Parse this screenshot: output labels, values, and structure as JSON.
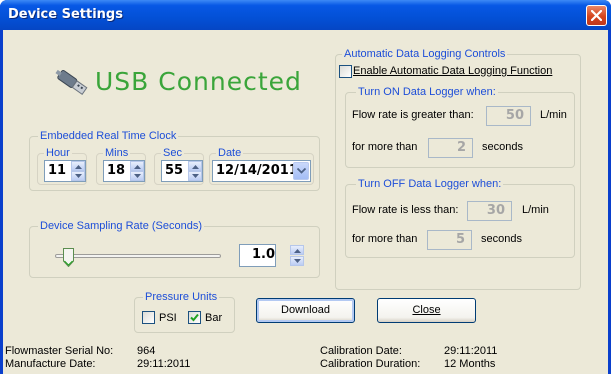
{
  "window": {
    "title": "Device Settings"
  },
  "usb": {
    "status_text": "USB Connected",
    "icon": "usb-plug-icon"
  },
  "rtc": {
    "group_label": "Embedded Real Time Clock",
    "hour_label": "Hour",
    "mins_label": "Mins",
    "sec_label": "Sec",
    "date_label": "Date",
    "hour_value": "11",
    "mins_value": "18",
    "sec_value": "55",
    "date_value": "12/14/2011"
  },
  "sampling": {
    "group_label": "Device Sampling Rate (Seconds)",
    "value": "1.0",
    "slider_level": 0.05
  },
  "logging": {
    "group_label": "Automatic Data Logging Controls",
    "enable_label": "Enable Automatic Data Logging Function",
    "enable_checked": false,
    "on_group_label": "Turn ON Data Logger when:",
    "on_flow_label": "Flow rate is greater than:",
    "on_flow_value": "50",
    "on_flow_unit": "L/min",
    "on_time_label": "for more than",
    "on_time_value": "2",
    "on_time_unit": "seconds",
    "off_group_label": "Turn OFF Data Logger when:",
    "off_flow_label": "Flow rate is less than:",
    "off_flow_value": "30",
    "off_flow_unit": "L/min",
    "off_time_label": "for more than",
    "off_time_value": "5",
    "off_time_unit": "seconds"
  },
  "pressure": {
    "group_label": "Pressure Units",
    "psi_label": "PSI",
    "psi_checked": false,
    "bar_label": "Bar",
    "bar_checked": true
  },
  "buttons": {
    "download_label": "Download",
    "close_label": "Close"
  },
  "info": {
    "serial_label": "Flowmaster Serial No:",
    "serial_value": "964",
    "manufacture_label": "Manufacture Date:",
    "manufacture_value": "29:11:2011",
    "calibration_label": "Calibration Date:",
    "calibration_value": "29:11:2011",
    "duration_label": "Calibration Duration:",
    "duration_value": "12 Months"
  },
  "colors": {
    "titlebar": "#0350d6",
    "group_label": "#1d4ed8",
    "usb_text": "#3aa53a",
    "dialog_bg": "#ece9d8"
  }
}
